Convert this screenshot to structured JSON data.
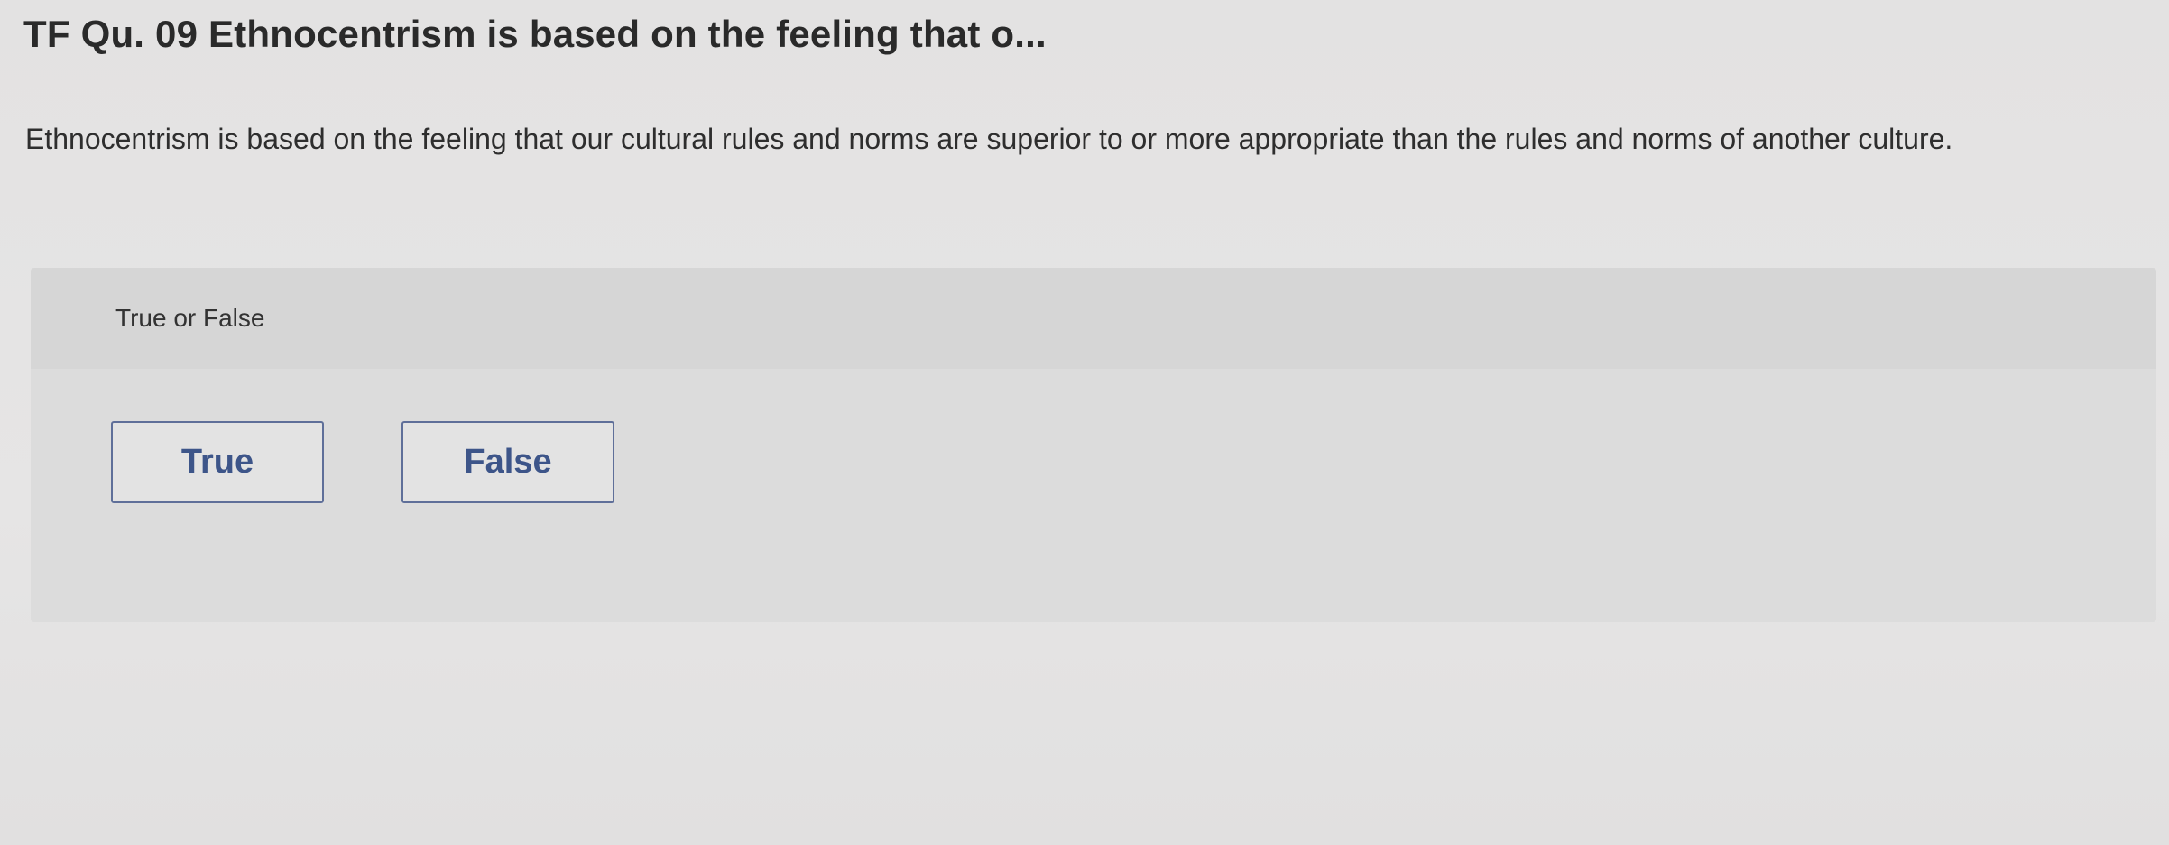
{
  "question": {
    "title": "TF Qu. 09 Ethnocentrism is based on the feeling that o...",
    "text": "Ethnocentrism is based on the feeling that our cultural rules and norms are superior to or more appropriate than the rules and norms of another culture."
  },
  "answer_panel": {
    "prompt": "True or False",
    "choices": [
      {
        "label": "True"
      },
      {
        "label": "False"
      }
    ]
  },
  "colors": {
    "background": "#e4e3e3",
    "panel": "#dcdcdc",
    "panel_header": "#d6d6d6",
    "button_border": "#5f6f99",
    "button_text": "#3d5589"
  }
}
